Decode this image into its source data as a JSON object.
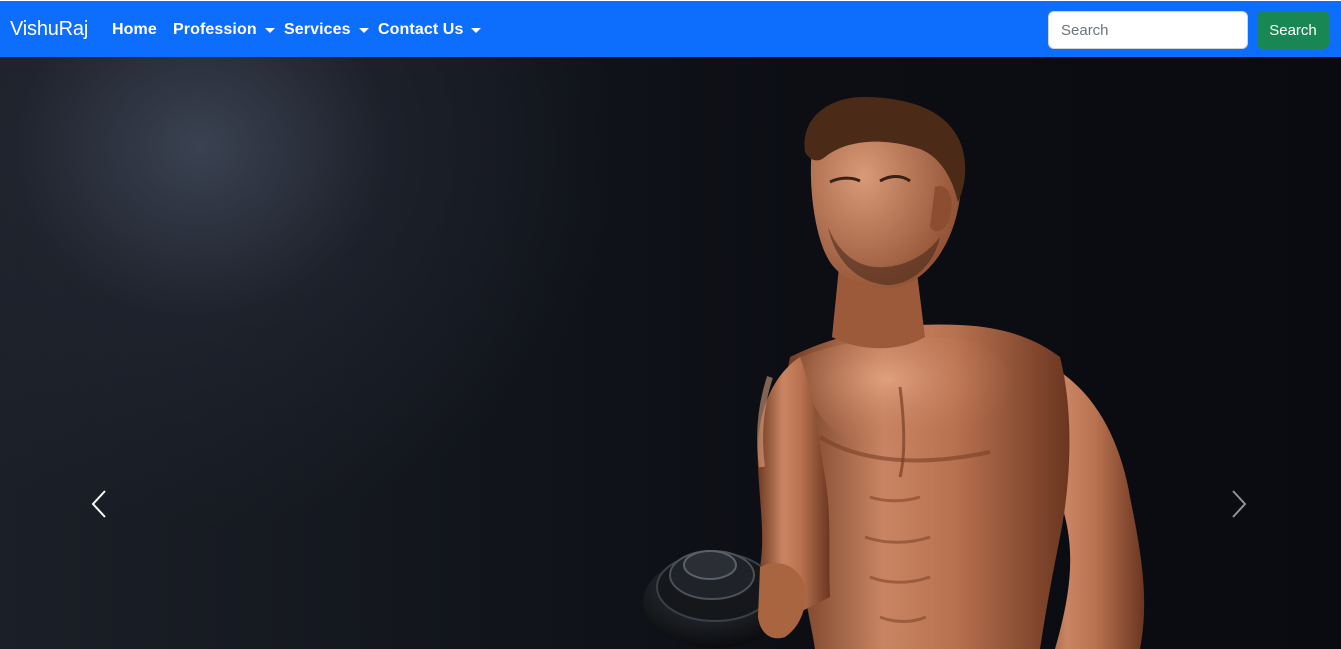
{
  "navbar": {
    "brand": "VishuRaj",
    "links": [
      {
        "label": "Home",
        "dropdown": false
      },
      {
        "label": "Profession",
        "dropdown": true
      },
      {
        "label": "Services",
        "dropdown": true
      },
      {
        "label": "Contact Us",
        "dropdown": true
      }
    ],
    "search": {
      "placeholder": "Search",
      "value": "",
      "button_label": "Search"
    }
  },
  "carousel": {
    "slide_image": "man-lifting-dumbbell-photo",
    "controls": {
      "prev_icon": "chevron-left-icon",
      "next_icon": "chevron-right-icon"
    }
  },
  "colors": {
    "navbar_bg": "#0d6efd",
    "search_button_bg": "#198754",
    "hero_bg": "#0d0f14"
  }
}
